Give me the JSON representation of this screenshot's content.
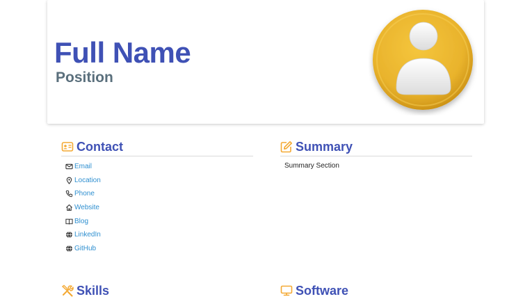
{
  "header": {
    "full_name": "Full Name",
    "position": "Position"
  },
  "avatar": {
    "icon": "user-avatar-icon",
    "circle_color": "#e9b32c",
    "figure_color": "#f2f2f2"
  },
  "sections": {
    "contact": {
      "title": "Contact",
      "icon": "id-card-icon",
      "items": [
        {
          "icon": "mail-icon",
          "label": "Email"
        },
        {
          "icon": "map-pin-icon",
          "label": "Location"
        },
        {
          "icon": "phone-icon",
          "label": "Phone"
        },
        {
          "icon": "home-icon",
          "label": "Website"
        },
        {
          "icon": "book-icon",
          "label": "Blog"
        },
        {
          "icon": "globe-icon",
          "label": "LinkedIn"
        },
        {
          "icon": "globe-icon",
          "label": "GitHub"
        }
      ]
    },
    "summary": {
      "title": "Summary",
      "icon": "edit-icon",
      "text": "Summary Section"
    },
    "skills": {
      "title": "Skills",
      "icon": "tools-icon"
    },
    "software": {
      "title": "Software",
      "icon": "monitor-icon"
    }
  },
  "colors": {
    "title_blue": "#3f51b5",
    "position_gray": "#5a6f7c",
    "icon_orange": "#f4a933",
    "link_blue": "#2e8fd0"
  }
}
